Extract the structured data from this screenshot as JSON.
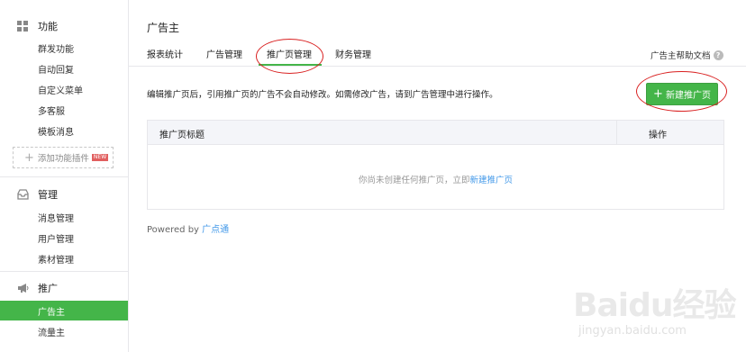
{
  "sidebar": {
    "features": {
      "heading": "功能",
      "icon": "grid-icon",
      "items": [
        "群发功能",
        "自动回复",
        "自定义菜单",
        "多客服",
        "模板消息"
      ],
      "add_plugin": "添加功能插件",
      "new_badge": "NEW"
    },
    "manage": {
      "heading": "管理",
      "icon": "inbox-icon",
      "items": [
        "消息管理",
        "用户管理",
        "素材管理"
      ]
    },
    "promote": {
      "heading": "推广",
      "icon": "megaphone-icon",
      "items": [
        "广告主",
        "流量主"
      ],
      "active_index": 0
    }
  },
  "main": {
    "title": "广告主",
    "tabs": [
      "报表统计",
      "广告管理",
      "推广页管理",
      "财务管理"
    ],
    "active_tab": 2,
    "help_link": "广告主帮助文档",
    "description": "编辑推广页后，引用推广页的广告不会自动修改。如需修改广告，请到广告管理中进行操作。",
    "new_button": "新建推广页",
    "table": {
      "columns": [
        "推广页标题",
        "操作"
      ],
      "empty_text": "你尚未创建任何推广页，立即",
      "empty_link": "新建推广页"
    },
    "powered_by": "Powered by",
    "powered_link": "广点通"
  },
  "watermark": {
    "brand": "Baidu经验",
    "url": "jingyan.baidu.com"
  },
  "colors": {
    "accent": "#44b549",
    "link": "#459ae9",
    "annotation": "#d92020"
  }
}
